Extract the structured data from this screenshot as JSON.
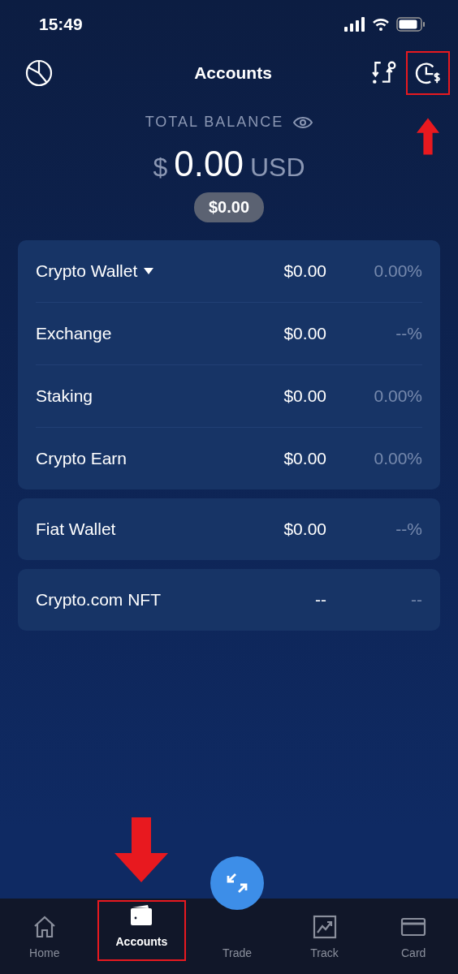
{
  "status_bar": {
    "time": "15:49"
  },
  "header": {
    "title": "Accounts",
    "right_buttons": [
      {
        "kind": "transfer",
        "highlighted": false
      },
      {
        "kind": "history",
        "highlighted": true
      }
    ]
  },
  "balance": {
    "label": "TOTAL BALANCE",
    "currency_symbol": "$",
    "amount": "0.00",
    "currency": "USD",
    "secondary": "$0.00"
  },
  "groups": [
    {
      "rows": [
        {
          "name": "Crypto Wallet",
          "has_menu": true,
          "amount": "$0.00",
          "change": "0.00%"
        },
        {
          "name": "Exchange",
          "has_menu": false,
          "amount": "$0.00",
          "change": "--%"
        },
        {
          "name": "Staking",
          "has_menu": false,
          "amount": "$0.00",
          "change": "0.00%"
        },
        {
          "name": "Crypto Earn",
          "has_menu": false,
          "amount": "$0.00",
          "change": "0.00%"
        }
      ]
    },
    {
      "rows": [
        {
          "name": "Fiat Wallet",
          "has_menu": false,
          "amount": "$0.00",
          "change": "--%"
        }
      ]
    },
    {
      "rows": [
        {
          "name": "Crypto.com NFT",
          "has_menu": false,
          "amount": "--",
          "change": "--"
        }
      ]
    }
  ],
  "tab_bar": [
    {
      "kind": "home",
      "label": "Home",
      "selected": false,
      "highlighted": false
    },
    {
      "kind": "accounts",
      "label": "Accounts",
      "selected": true,
      "highlighted": true
    },
    {
      "kind": "trade",
      "label": "Trade",
      "selected": false,
      "highlighted": false
    },
    {
      "kind": "track",
      "label": "Track",
      "selected": false,
      "highlighted": false
    },
    {
      "kind": "card",
      "label": "Card",
      "selected": false,
      "highlighted": false
    }
  ]
}
